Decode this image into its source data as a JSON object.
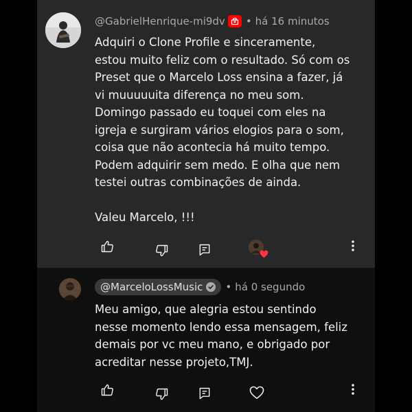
{
  "comment": {
    "author": "@GabrielHenrique-mi9dv",
    "separator": "•",
    "time": "há 16 minutos",
    "text": "Adquiri o Clone Profile e sinceramente,\nestou muito feliz com o resultado. Só com os\nPreset que o Marcelo Loss ensina a fazer, já\nvi muuuuuita diferença no meu som.\nDomingo passado eu toquei com eles na\nigreja e surgiram vários elogios para o som,\ncoisa que não acontecia há muito tempo.\nPodem adquirir sem medo. E olha que nem\ntestei outras combinações de ainda.\n\nValeu Marcelo, !!!",
    "actions": {
      "like_icon": "thumbs-up-icon",
      "dislike_icon": "thumbs-down-icon",
      "reply_icon": "reply-icon",
      "creator_heart_icon": "heart-icon",
      "more_icon": "more-vert-icon"
    }
  },
  "reply": {
    "author": "@MarceloLossMusic",
    "separator": "•",
    "time": "há 0 segundo",
    "text": "Meu amigo, que alegria estou sentindo\nnesse momento lendo essa mensagem, feliz\ndemais por vc meu mano, e obrigado por\nacreditar nesse projeto,TMJ.",
    "actions": {
      "like_icon": "thumbs-up-icon",
      "dislike_icon": "thumbs-down-icon",
      "reply_icon": "reply-icon",
      "heart_icon": "heart-outline-icon",
      "more_icon": "more-vert-icon"
    }
  },
  "colors": {
    "background": "#000000",
    "comment_panel": "#282828",
    "reply_panel": "#0f0f0f",
    "badge_red": "#ff0000",
    "heart_red": "#ff3344"
  }
}
